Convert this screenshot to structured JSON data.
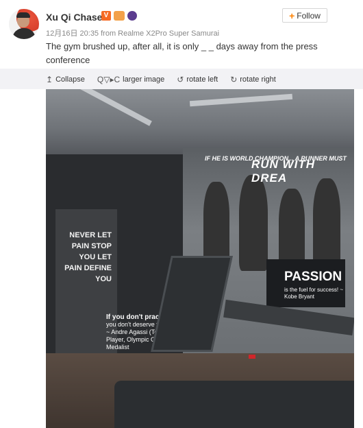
{
  "post": {
    "author": "Xu Qi Chase",
    "badge_v": "V",
    "meta": "12月16日 20:35 from Realme X2Pro Super Samurai",
    "follow_label": "Follow",
    "follow_plus": "+",
    "text": "The gym brushed up, after all, it is only _ _ days away from the press conference"
  },
  "toolbar": {
    "collapse_label": "Collapse",
    "larger_label": "larger image",
    "rotate_left_label": "rotate left",
    "rotate_right_label": "rotate right",
    "collapse_icon": "↥",
    "tools_icon": "Q▽▸C",
    "rotate_left_icon": "↺",
    "rotate_right_icon": "↻"
  },
  "photo": {
    "quote_left": "NEVER LET PAIN STOP YOU LET PAIN DEFINE YOU",
    "mural_small": "IF HE IS WORLD CHAMPION... A RUNNER MUST",
    "mural_big": "RUN WITH DREA",
    "passion": "PASSION",
    "passion_sub": "is the fuel for success! ~ Kobe Bryant",
    "bottom_quote_big": "If you don't practice",
    "bottom_quote_small": "you don't deserve to win. ~ Andre Agassi (Tennis Player, Olympic Gold Medalist"
  },
  "colors": {
    "accent": "#ff8200",
    "badge_v": "#f66a24",
    "text": "#333333",
    "meta": "#888888"
  }
}
